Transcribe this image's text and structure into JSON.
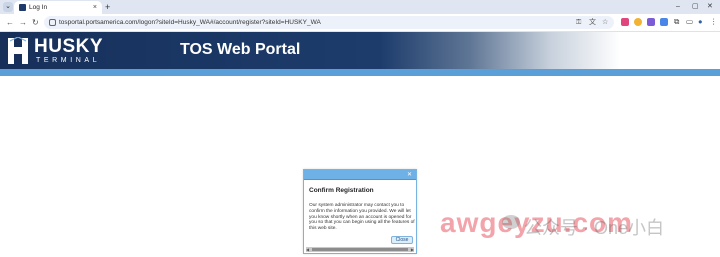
{
  "browser": {
    "tab_title": "Log In",
    "tab_close": "×",
    "new_tab": "+",
    "tab_menu": "⌄",
    "url": "tosportal.portsamerica.com/logon?siteId=Husky_WA#/account/register?siteId=HUSKY_WA",
    "nav": {
      "back": "←",
      "forward": "→",
      "reload": "↻"
    },
    "window": {
      "minimize": "–",
      "maximize": "▢",
      "close": "✕"
    },
    "toolbar_icons": {
      "key": "⚿",
      "translate": "文",
      "star": "☆",
      "extensions": "⧉",
      "split": "▭",
      "profile": "●",
      "menu": "⋮"
    }
  },
  "site": {
    "logo_text": "HUSKY",
    "logo_subtext": "TERMINAL",
    "portal_title": "TOS Web Portal"
  },
  "dialog": {
    "close_icon": "✕",
    "heading": "Confirm Registration",
    "body": "Our system administrator may contact you to confirm the information you provided. We will let you know shortly when an account is opened for you so that you can begin using all the features of this web site.",
    "close_button": "Close",
    "scroll_left": "◀",
    "scroll_right": "▶"
  },
  "watermark": {
    "text": "awgeyzu.com",
    "cn_text": "公众号 · One小白"
  },
  "colors": {
    "header_dark": "#17305a",
    "header_bar": "#5b9fd9",
    "dialog_title": "#6eb1e6"
  }
}
